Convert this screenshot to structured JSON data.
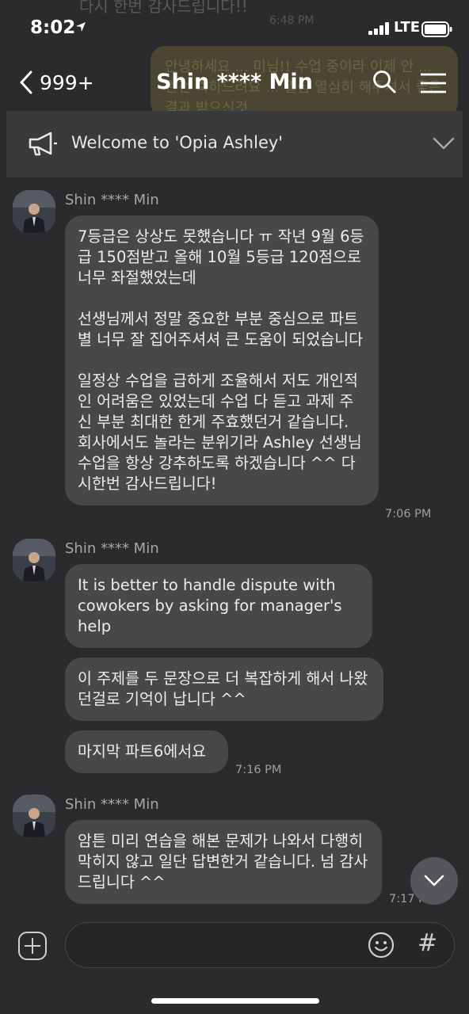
{
  "status": {
    "time": "8:02",
    "network": "LTE"
  },
  "ghost": {
    "top_text": "다시 한번 감사드립니다!!",
    "time": "6:48 PM",
    "bubble_text": "안녕하세요 ... 미님!! 수업 중이라 이제 안 ... 완전 축하드려요 ... 열심 열심히 해주셔서 좋은 결과 받으신것"
  },
  "header": {
    "back_count": "999+",
    "title": "Shin **** Min"
  },
  "notice": {
    "text": "Welcome to 'Opia Ashley'"
  },
  "messages": [
    {
      "sender": "Shin **** Min",
      "paragraphs": [
        "7등급은 상상도 못했습니다 ㅠ 작년 9월 6등급 150점받고 올해 10월 5등급 120점으로 너무 좌절했었는데",
        "선생님께서 정말 중요한 부분 중심으로 파트별 너무 잘 집어주셔셔 큰 도움이 되었습니다",
        "일정상 수업을 급하게 조율해서 저도 개인적인 어려움은 있었는데 수업 다 듣고 과제 주신 부분 최대한 한게 주효했던거 같습니다. 회사에서도 놀라는 분위기라 Ashley 선생님 수업을 항상 강추하도록 하겠습니다 ^^ 다시한번 감사드립니다!"
      ],
      "time": "7:06 PM"
    },
    {
      "sender": "Shin **** Min",
      "bubbles": [
        "It is better to handle dispute with cowokers by asking for manager's help",
        "이 주제를 두 문장으로 더 복잡하게 해서 나왔던걸로 기억이 납니다 ^^",
        "마지막 파트6에서요"
      ],
      "time": "7:16 PM"
    },
    {
      "sender": "Shin **** Min",
      "bubbles": [
        "암튼 미리 연습을 해본 문제가 나와서 다행히 막히지 않고 일단 답변한거 같습니다. 넘 감사드립니다 ^^"
      ],
      "time": "7:17 PM"
    }
  ],
  "input": {
    "placeholder": "",
    "hash_label": "#"
  },
  "colors": {
    "background": "#2b2b2d",
    "bubble": "#48484b",
    "notice": "#3a3a3c"
  },
  "icons": [
    "back-chevron-icon",
    "search-icon",
    "menu-icon",
    "megaphone-icon",
    "chevron-down-icon",
    "plus-icon",
    "emoji-icon",
    "hash-icon",
    "scroll-down-icon"
  ]
}
